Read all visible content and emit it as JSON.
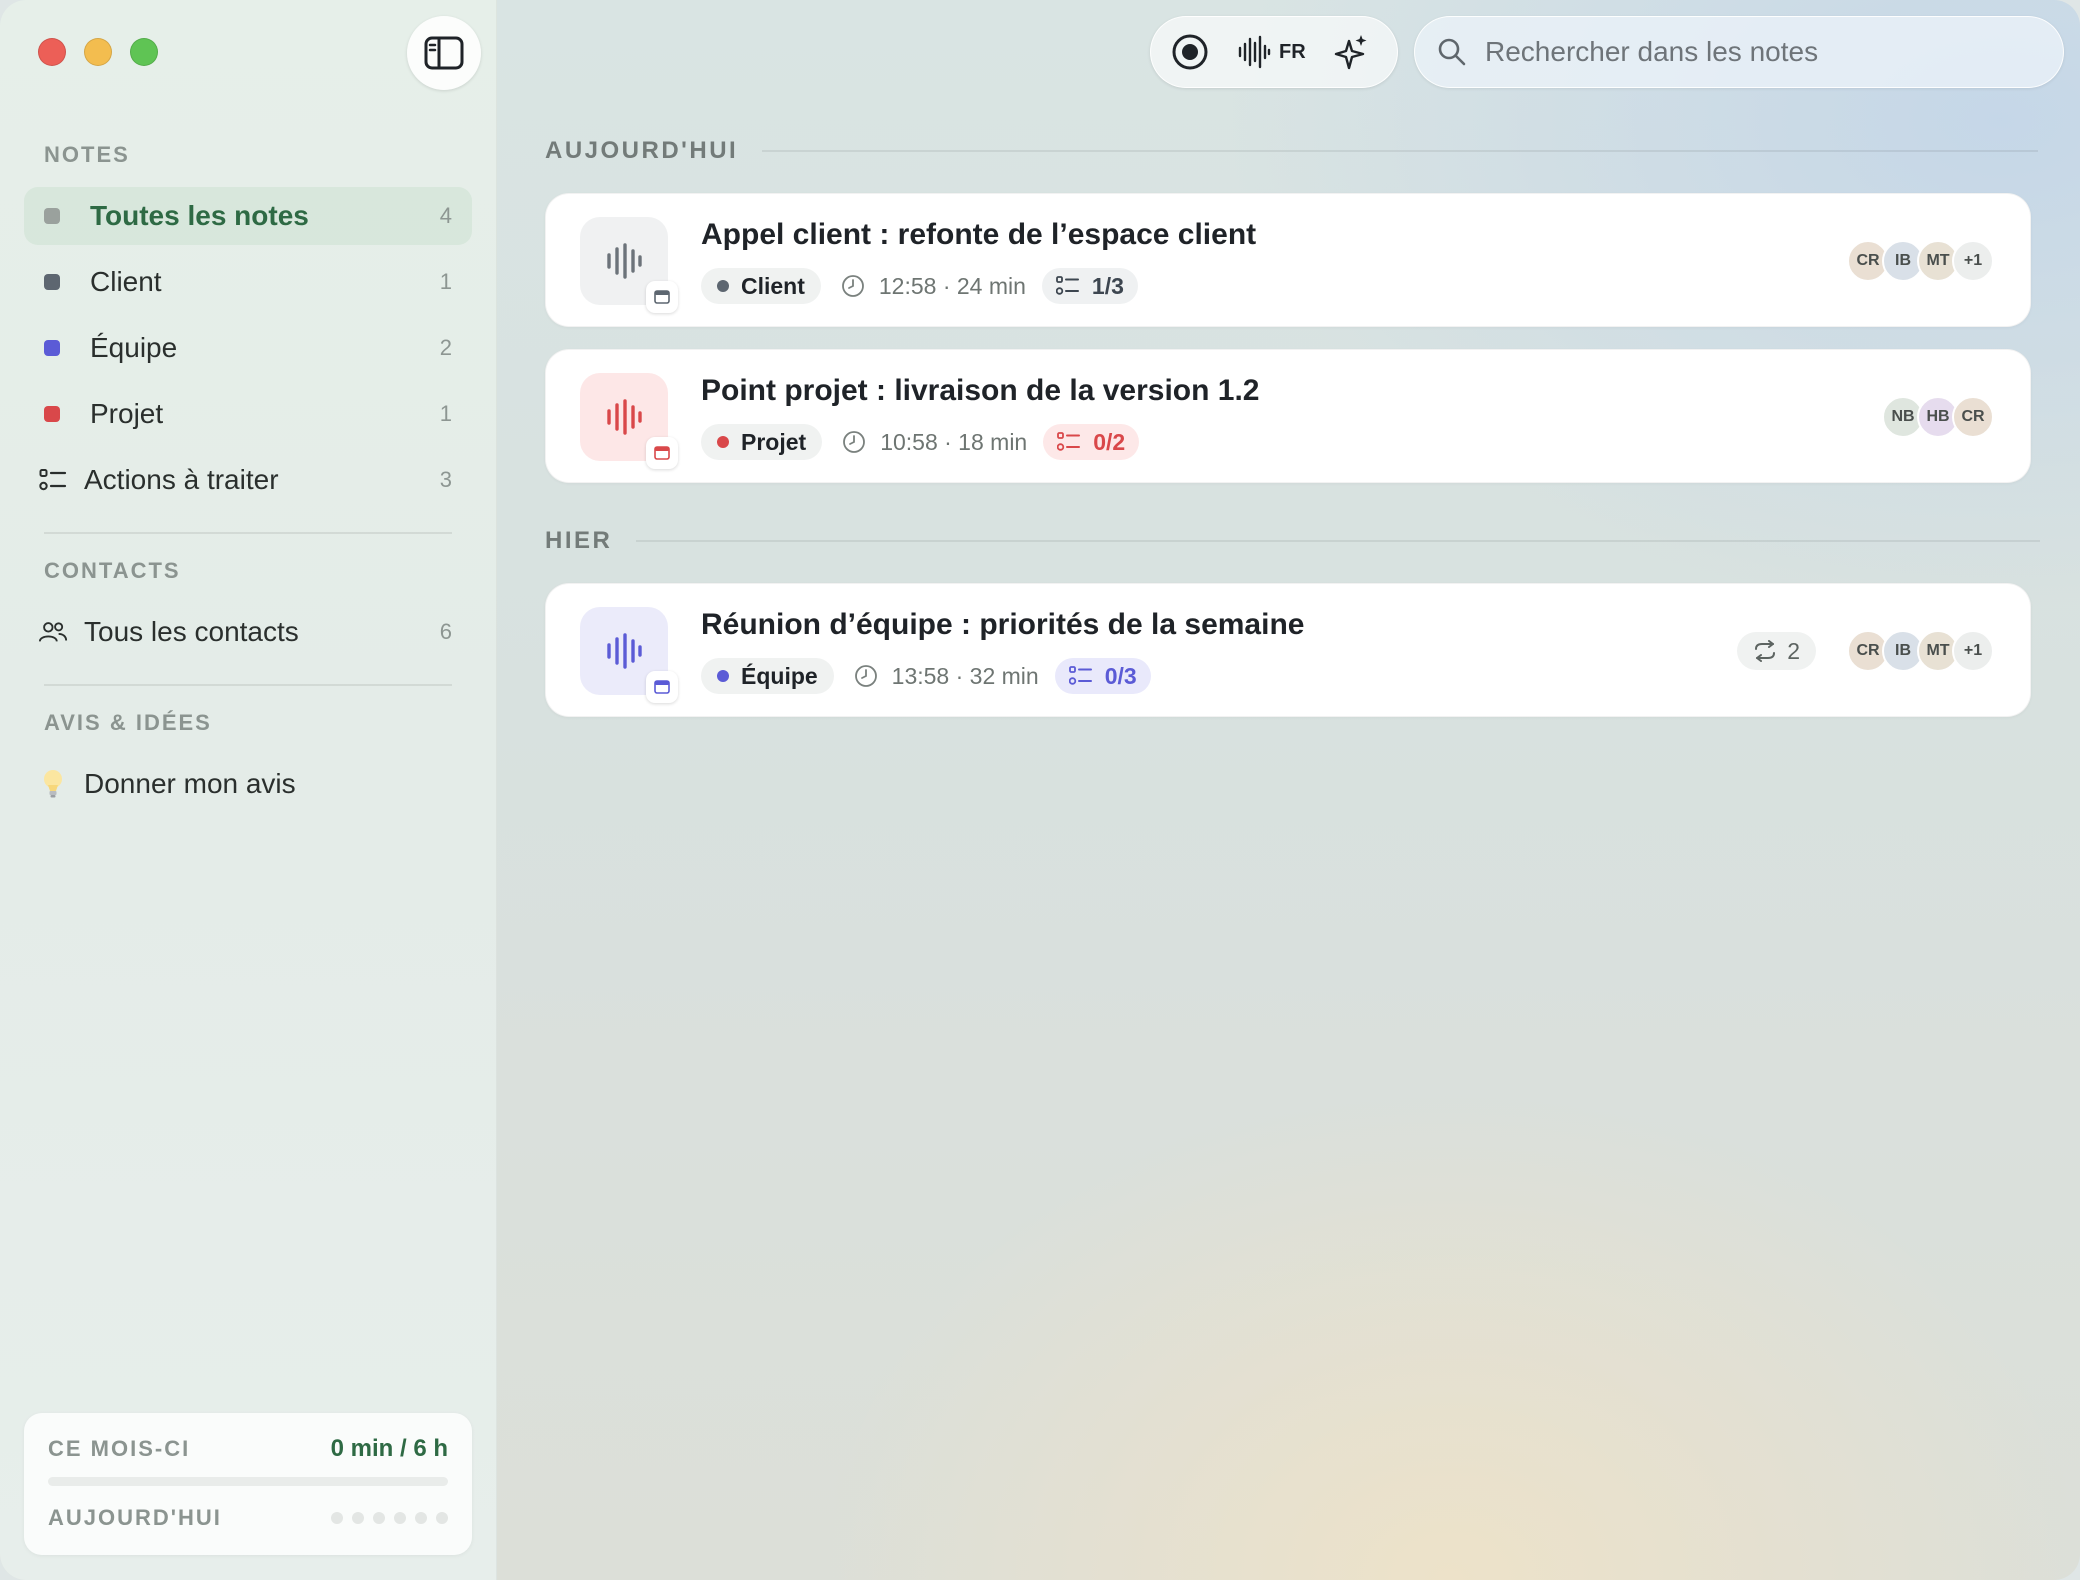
{
  "sidebar": {
    "toggle_icon": "sidebar-toggle-icon",
    "notes_section": "NOTES",
    "items": [
      {
        "label": "Toutes les notes",
        "count": "4",
        "color": "#9aa19d",
        "active": true
      },
      {
        "label": "Client",
        "count": "1",
        "color": "#5d6670"
      },
      {
        "label": "Équipe",
        "count": "2",
        "color": "#5b5bd6"
      },
      {
        "label": "Projet",
        "count": "1",
        "color": "#d9484a"
      },
      {
        "label": "Actions à traiter",
        "count": "3",
        "icon": "checklist-icon"
      }
    ],
    "contacts_section": "CONTACTS",
    "contacts_item": {
      "label": "Tous les contacts",
      "count": "6",
      "icon": "people-icon"
    },
    "feedback_section": "AVIS & IDÉES",
    "feedback_item": {
      "label": "Donner mon avis",
      "icon": "lightbulb-icon"
    },
    "usage": {
      "month_label": "CE MOIS-CI",
      "month_value": "0 min / 6 h",
      "month_progress": 0,
      "today_label": "AUJOURD'HUI",
      "today_dots": 6
    }
  },
  "toolbar": {
    "record_icon": "record-icon",
    "waveform_icon": "waveform-icon",
    "language": "FR",
    "sparkle_icon": "sparkle-icon"
  },
  "search": {
    "placeholder": "Rechercher dans les notes",
    "icon": "search-icon"
  },
  "groups": [
    {
      "title": "AUJOURD'HUI",
      "notes": [
        {
          "title": "Appel client : refonte de l’espace client",
          "tag": "Client",
          "tag_color": "#5d6670",
          "time": "12:58 · 24 min",
          "actions": "1/3",
          "actions_color": "#3d4650",
          "actions_bg": "#eff1f2",
          "thumb_bg": "#f0f1f2",
          "wave_color": "#6c737a",
          "avatars": [
            "CR",
            "IB",
            "MT",
            "+1"
          ]
        },
        {
          "title": "Point projet : livraison de la version 1.2",
          "tag": "Projet",
          "tag_color": "#d9484a",
          "time": "10:58 · 18 min",
          "actions": "0/2",
          "actions_color": "#d9484a",
          "actions_bg": "#fde8e8",
          "thumb_bg": "#fde7e7",
          "wave_color": "#d9484a",
          "avatars": [
            "NB",
            "HB",
            "CR"
          ]
        }
      ]
    },
    {
      "title": "HIER",
      "notes": [
        {
          "title": "Réunion d’équipe : priorités de la semaine",
          "tag": "Équipe",
          "tag_color": "#5b5bd6",
          "time": "13:58 · 32 min",
          "actions": "0/3",
          "actions_color": "#5b5bd6",
          "actions_bg": "#e9e9fb",
          "thumb_bg": "#ebebfa",
          "wave_color": "#5b5bd6",
          "repeat_count": "2",
          "avatars": [
            "CR",
            "IB",
            "MT",
            "+1"
          ]
        }
      ]
    }
  ]
}
